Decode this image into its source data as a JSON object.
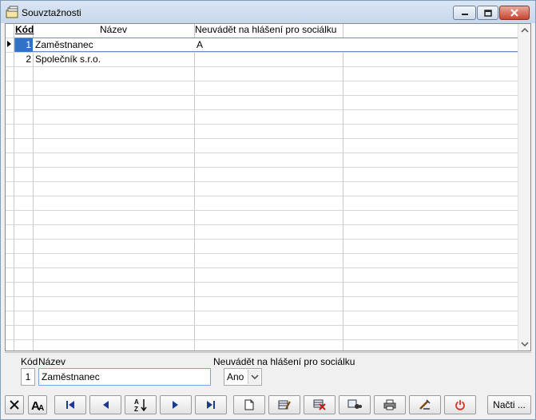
{
  "window": {
    "title": "Souvztažnosti",
    "icons": {
      "app": "folder-stack-icon",
      "minimize": "minimize-icon",
      "maximize": "maximize-icon",
      "close": "close-icon"
    }
  },
  "grid": {
    "columns": [
      "Kód",
      "Název",
      "Neuvádět na hlášení pro sociálku"
    ],
    "rows": [
      {
        "kod": "1",
        "nazev": "Zaměstnanec",
        "neuvadet": "A",
        "selected": true
      },
      {
        "kod": "2",
        "nazev": "Společník s.r.o.",
        "neuvadet": "",
        "selected": false
      }
    ]
  },
  "detail": {
    "kod_label": "Kód",
    "nazev_label": "Název",
    "neuvadet_label": "Neuvádět na hlášení pro sociálku",
    "kod_value": "1",
    "nazev_value": "Zaměstnanec",
    "neuvadet_value": "Ano"
  },
  "toolbar": {
    "buttons": [
      "delete-icon",
      "font-icon",
      "first-record-icon",
      "previous-record-icon",
      "sort-az-icon",
      "next-record-icon",
      "last-record-icon",
      "new-document-icon",
      "edit-icon",
      "delete-record-icon",
      "find-icon",
      "print-icon",
      "tools-icon",
      "power-icon"
    ],
    "load_label": "Načti ..."
  },
  "colors": {
    "selection": "#3171c7",
    "title_bar": "#c7d7ec",
    "power": "#d93025"
  }
}
